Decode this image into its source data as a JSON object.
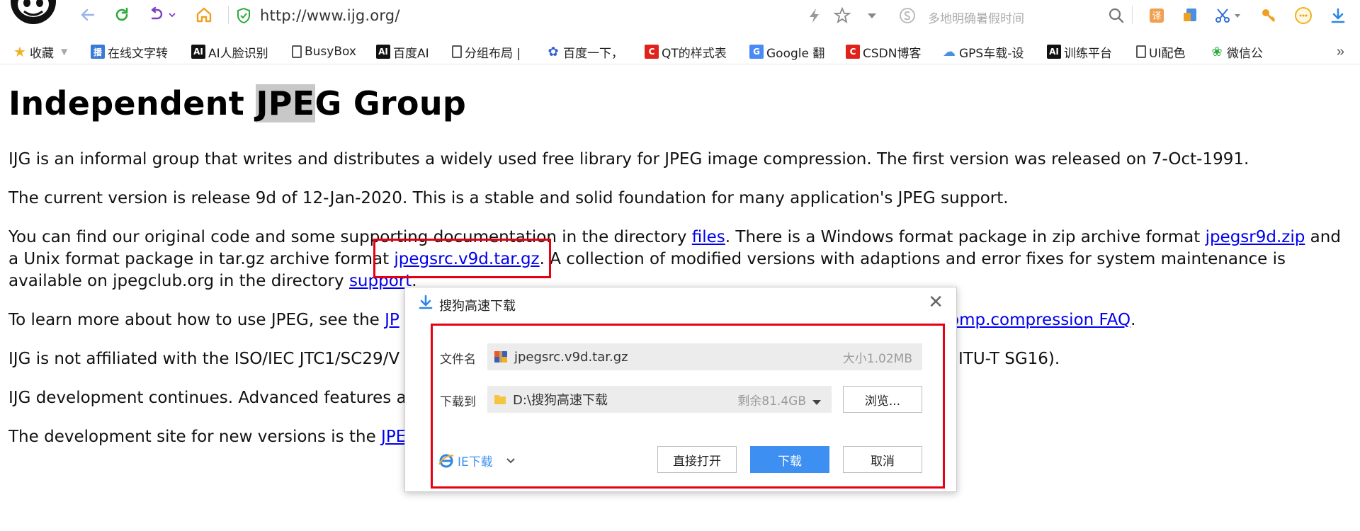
{
  "browser": {
    "url": "http://www.ijg.org/",
    "search_placeholder": "多地明确暑假时间"
  },
  "bookmarks": [
    {
      "label": "收藏",
      "icon": "star-icon"
    },
    {
      "label": "在线文字转",
      "icon": "bookmark-icon"
    },
    {
      "label": "AI人脸识别",
      "icon": "ai-icon"
    },
    {
      "label": "BusyBox",
      "icon": "page-icon"
    },
    {
      "label": "百度AI",
      "icon": "ai-icon"
    },
    {
      "label": "分组布局 |",
      "icon": "page-icon"
    },
    {
      "label": "百度一下，",
      "icon": "baidu-paw-icon"
    },
    {
      "label": "QT的样式表",
      "icon": "csdn-icon"
    },
    {
      "label": "Google 翻",
      "icon": "google-translate-icon"
    },
    {
      "label": "CSDN博客",
      "icon": "csdn-icon"
    },
    {
      "label": "GPS车载-设",
      "icon": "cloud-icon"
    },
    {
      "label": "训练平台",
      "icon": "ai-icon"
    },
    {
      "label": "UI配色",
      "icon": "page-icon"
    },
    {
      "label": "微信公",
      "icon": "wechat-icon"
    }
  ],
  "page": {
    "title_pre": "Independent ",
    "title_hl": "JPE",
    "title_post": "G Group",
    "p1": "IJG is an informal group that writes and distributes a widely used free library for JPEG image compression. The first version was released on 7-Oct-1991.",
    "p2": "The current version is release 9d of 12-Jan-2020. This is a stable and solid foundation for many application's JPEG support.",
    "p3_a": "You can find our original code and some supporting documentation in the directory ",
    "p3_link1": "files",
    "p3_b": ". There is a Windows format package in zip archive format ",
    "p3_link2": "jpegsr9d.zip",
    "p3_c": " and a Unix format package in tar.gz archive format ",
    "p3_link3": "jpegsrc.v9d.tar.gz",
    "p3_d": ". A collection of modified versions with adaptions and error fixes for system maintenance is available on jpegclub.org in the directory ",
    "p3_link4": "support",
    "p3_e": ".",
    "p4_a": "To learn more about how to use JPEG, see the ",
    "p4_link1": "JP",
    "p4_link2": "omp.compression FAQ",
    "p4_e": ".",
    "p5_a": "IJG is not affiliated with the ISO/IEC JTC1/SC29/V",
    "p5_b": "ITU-T SG16).",
    "p6_a": "IJG development continues. Advanced features a",
    "p7_a": "The development site for new versions is the ",
    "p7_link": "JPE"
  },
  "dialog": {
    "title": "搜狗高速下载",
    "filename_label": "文件名",
    "filename": "jpegsrc.v9d.tar.gz",
    "filesize": "大小1.02MB",
    "saveto_label": "下载到",
    "saveto_path": "D:\\搜狗高速下载",
    "free_space": "剩余81.4GB",
    "browse": "浏览...",
    "ie_download": "IE下载",
    "open_direct": "直接打开",
    "download": "下载",
    "cancel": "取消"
  },
  "colors": {
    "link": "#0000ee",
    "highlight_box": "#e60012",
    "primary_button": "#3d8ff2"
  }
}
